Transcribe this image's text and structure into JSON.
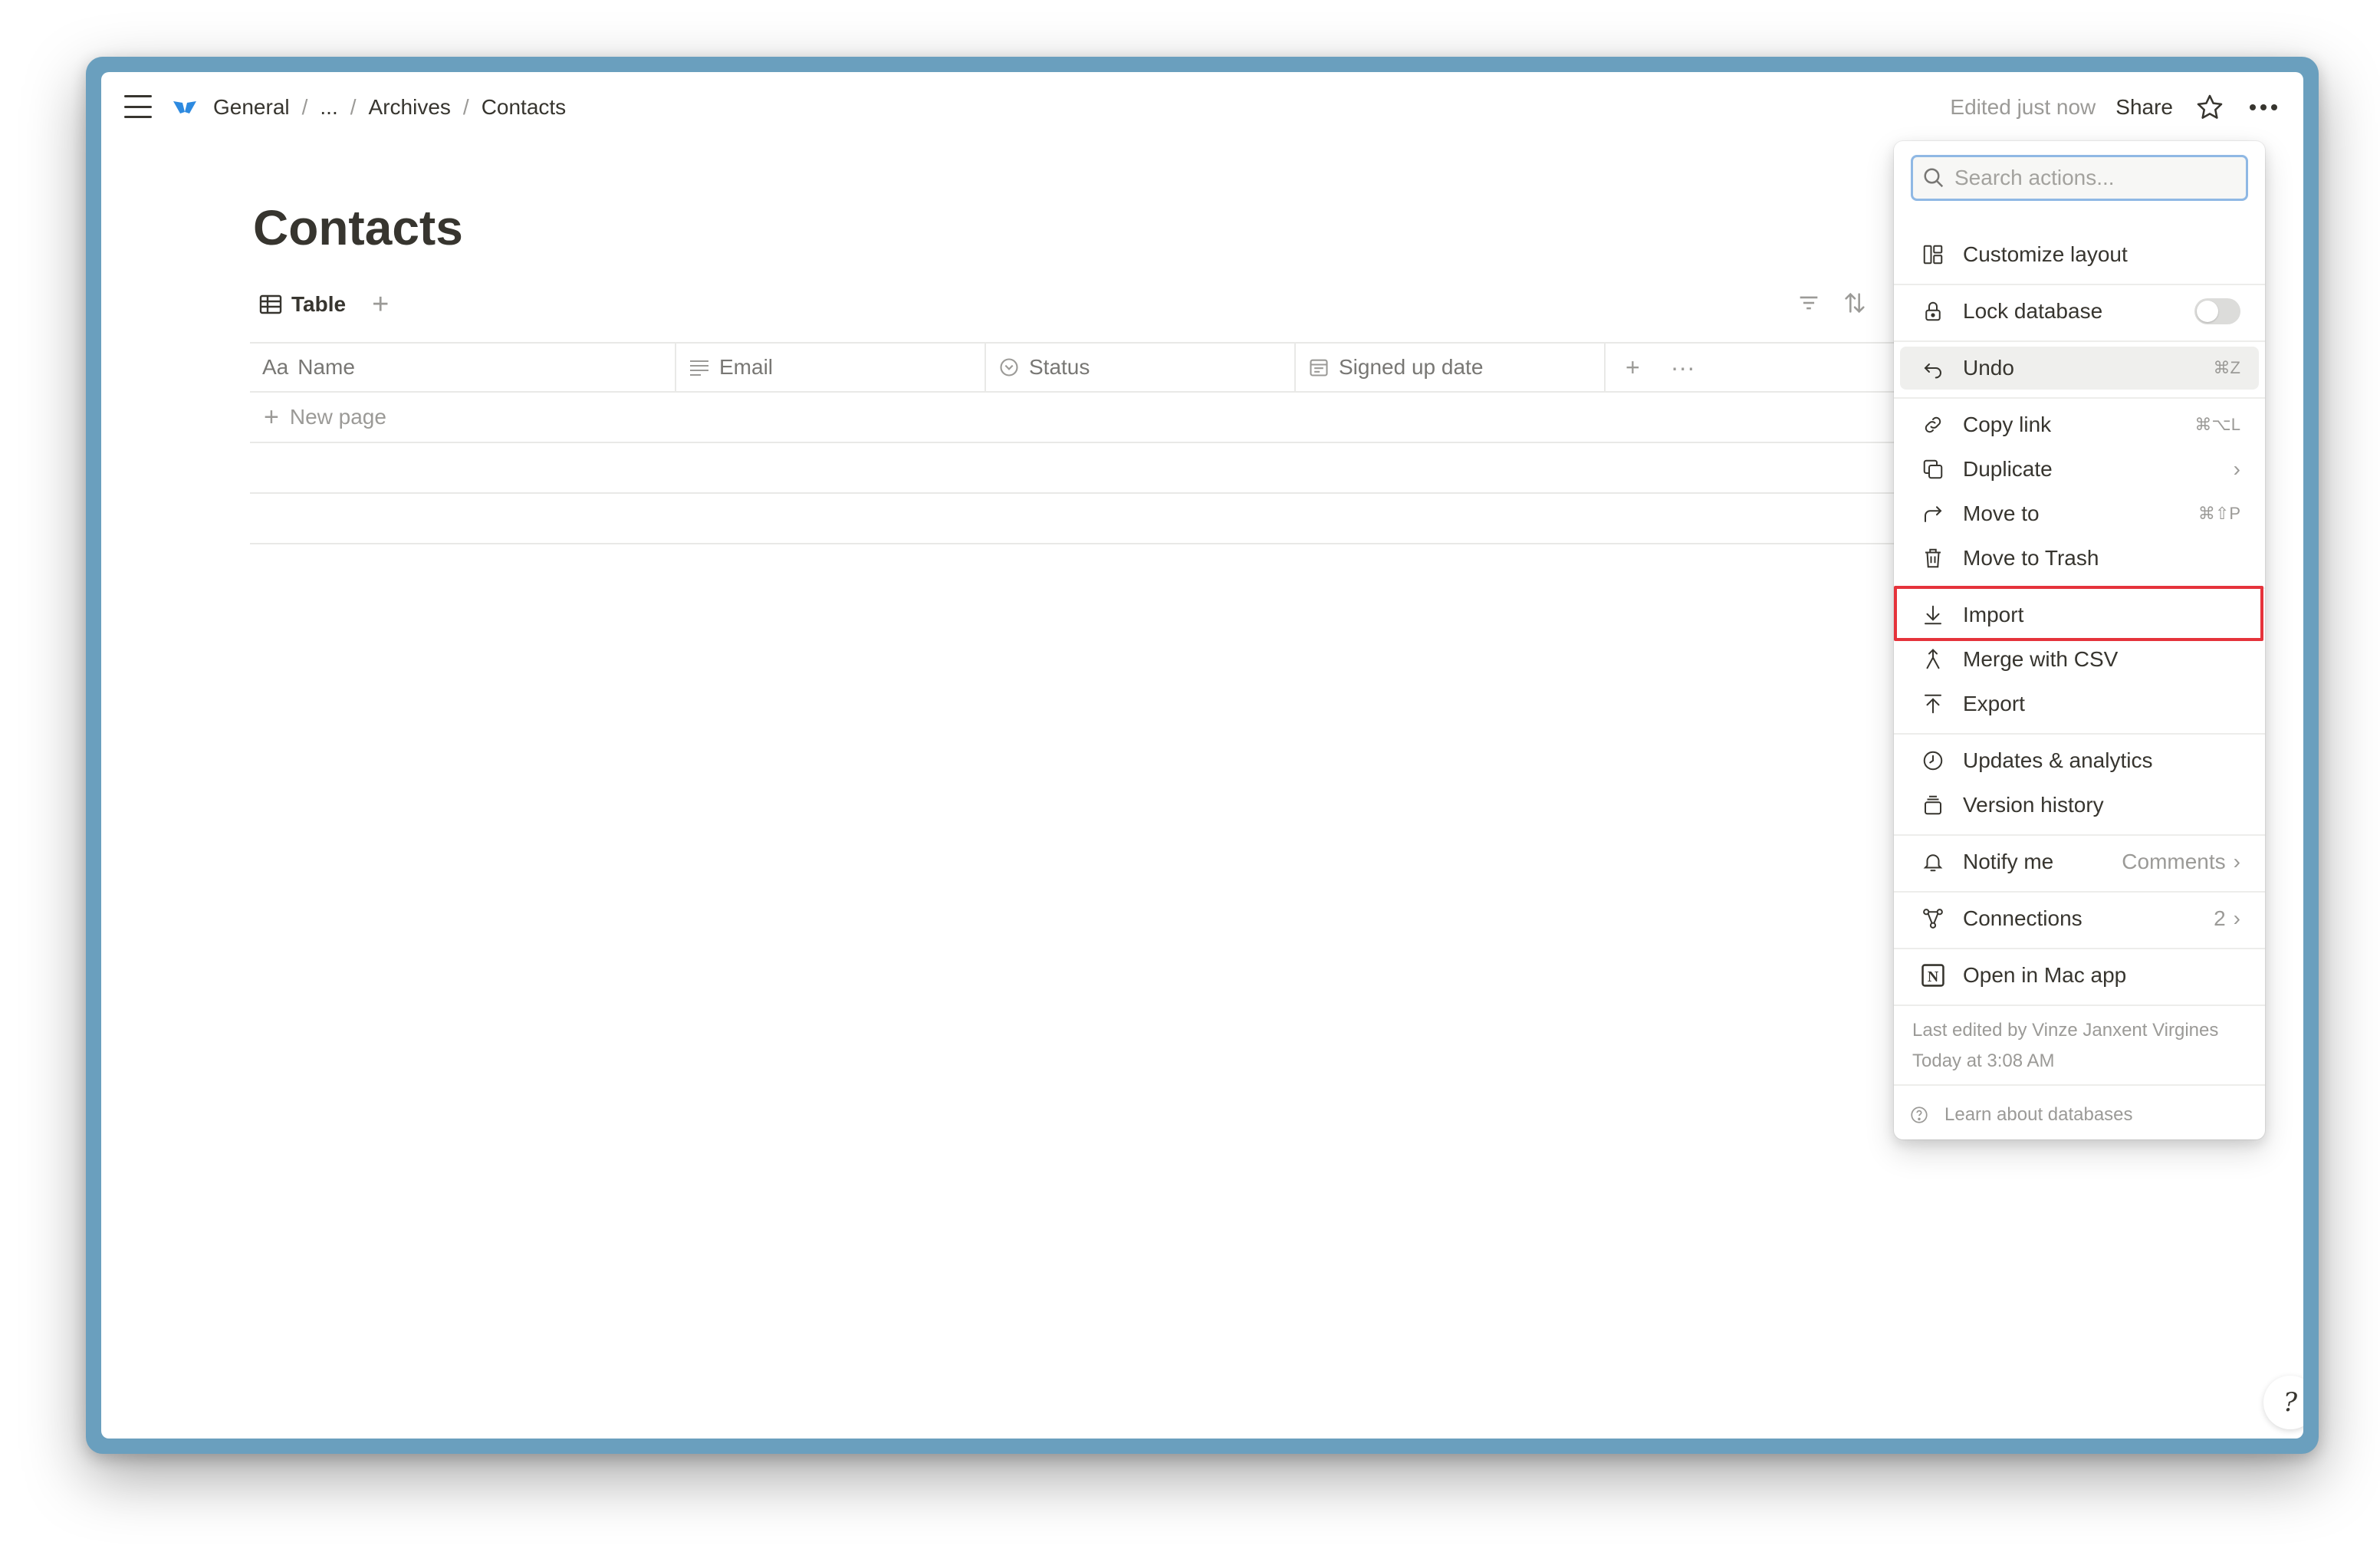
{
  "header": {
    "breadcrumbs": [
      "General",
      "...",
      "Archives",
      "Contacts"
    ],
    "separators": [
      "/",
      "/",
      "/"
    ],
    "edited_status": "Edited just now",
    "share_label": "Share"
  },
  "page": {
    "title": "Contacts",
    "view_tab": "Table",
    "columns": [
      {
        "prefix": "Aa",
        "label": "Name"
      },
      {
        "label": "Email"
      },
      {
        "label": "Status"
      },
      {
        "label": "Signed up date"
      }
    ],
    "new_page_label": "New page"
  },
  "menu": {
    "search_placeholder": "Search actions...",
    "items": [
      {
        "label": "Customize layout"
      },
      {
        "label": "Lock database"
      },
      {
        "label": "Undo",
        "shortcut": "⌘Z"
      },
      {
        "label": "Copy link",
        "shortcut": "⌘⌥L"
      },
      {
        "label": "Duplicate",
        "chevron": "›"
      },
      {
        "label": "Move to",
        "shortcut": "⌘⇧P"
      },
      {
        "label": "Move to Trash"
      },
      {
        "label": "Import"
      },
      {
        "label": "Merge with CSV"
      },
      {
        "label": "Export"
      },
      {
        "label": "Updates & analytics"
      },
      {
        "label": "Version history"
      },
      {
        "label": "Notify me",
        "value": "Comments",
        "chevron": "›"
      },
      {
        "label": "Connections",
        "value": "2",
        "chevron": "›"
      },
      {
        "label": "Open in Mac app"
      }
    ],
    "last_edited_by": "Last edited by Vinze Janxent Virgines",
    "last_edited_time": "Today at 3:08 AM",
    "learn_label": "Learn about databases"
  },
  "colors": {
    "highlight": "#e5333b",
    "frame": "#6a9fbe",
    "search_focus": "#8fb8e4"
  }
}
